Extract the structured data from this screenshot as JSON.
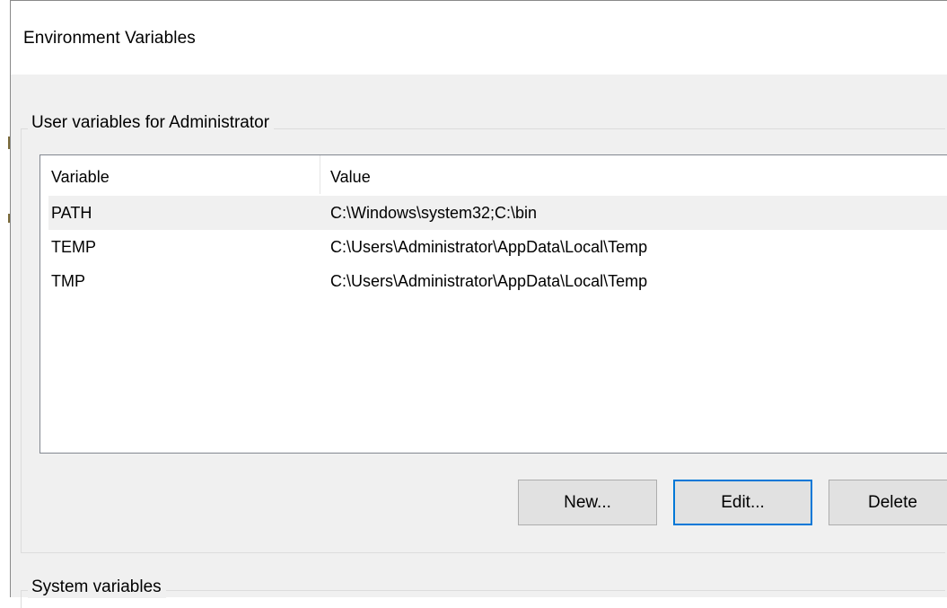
{
  "window": {
    "title": "Environment Variables"
  },
  "user_group": {
    "legend": "User variables for Administrator",
    "columns": {
      "variable": "Variable",
      "value": "Value"
    },
    "rows": [
      {
        "variable": "PATH",
        "value": "C:\\Windows\\system32;C:\\bin",
        "selected": true
      },
      {
        "variable": "TEMP",
        "value": "C:\\Users\\Administrator\\AppData\\Local\\Temp",
        "selected": false
      },
      {
        "variable": "TMP",
        "value": "C:\\Users\\Administrator\\AppData\\Local\\Temp",
        "selected": false
      }
    ],
    "buttons": {
      "new_label": "New...",
      "edit_label": "Edit...",
      "delete_label": "Delete"
    }
  },
  "system_group": {
    "legend": "System variables"
  },
  "colors": {
    "dialog_background": "#f0f0f0",
    "focus_border": "#0078d7",
    "selected_row": "#f0f0f0"
  }
}
